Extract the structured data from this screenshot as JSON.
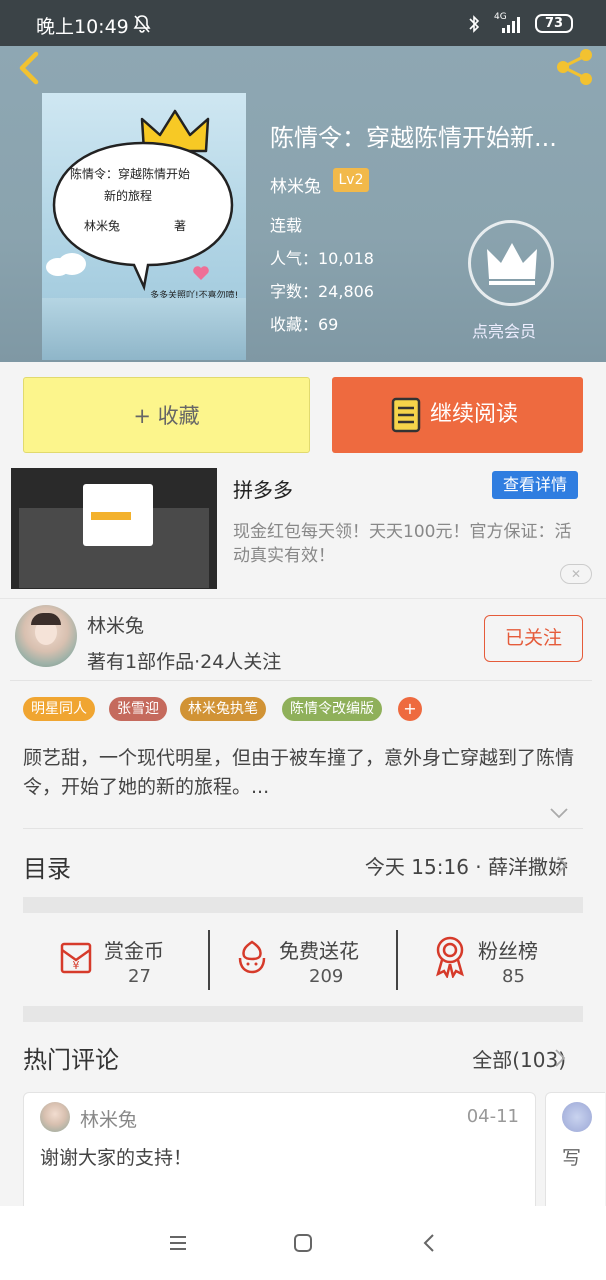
{
  "status_bar": {
    "time": "晚上10:49",
    "battery": "73",
    "network": "4G"
  },
  "book": {
    "title": "陈情令：穿越陈情开始新...",
    "author": "林米兔",
    "author_level": "Lv2",
    "status": "连载",
    "popularity": "人气：10,018",
    "word_count": "字数：24,806",
    "favorites": "收藏：69",
    "vip_label": "点亮会员",
    "cover_text_line1": "陈情令：穿越陈情开始",
    "cover_text_line2": "新的旅程",
    "cover_author": "林米兔",
    "cover_author_suffix": "著",
    "cover_footer": "多多关照吖!不喜勿喷!"
  },
  "actions": {
    "collect": "+ 收藏",
    "read": "继续阅读"
  },
  "ad": {
    "title": "拼多多",
    "button": "查看详情",
    "description": "现金红包每天领！天天100元！官方保证：活动真实有效！",
    "close": "✕"
  },
  "author_info": {
    "name": "林米兔",
    "stats": "著有1部作品·24人关注",
    "follow": "已关注"
  },
  "tags": [
    {
      "label": "明星同人",
      "color": "#f0a531"
    },
    {
      "label": "张雪迎",
      "color": "#c56a5d"
    },
    {
      "label": "林米兔执笔",
      "color": "#d19335"
    },
    {
      "label": "陈情令改编版",
      "color": "#8fb05a"
    }
  ],
  "tag_add": "+",
  "description": "顾艺甜，一个现代明星，但由于被车撞了，意外身亡穿越到了陈情令，开始了她的新的旅程。...",
  "toc": {
    "title": "目录",
    "latest": "今天 15:16 · 薛洋撒娇"
  },
  "stats": [
    {
      "label": "赏金币",
      "value": "27"
    },
    {
      "label": "免费送花",
      "value": "209"
    },
    {
      "label": "粉丝榜",
      "value": "85"
    }
  ],
  "hot_comments": {
    "title": "热门评论",
    "all": "全部(103)"
  },
  "comment": {
    "author": "林米兔",
    "date": "04-11",
    "text": "谢谢大家的支持！"
  },
  "comment2_partial": "写",
  "colors": {
    "accent": "#ee6a3f",
    "collect_bg": "#fcf58c",
    "ad_button": "#2f7de0",
    "icon_red": "#d63a2a"
  }
}
